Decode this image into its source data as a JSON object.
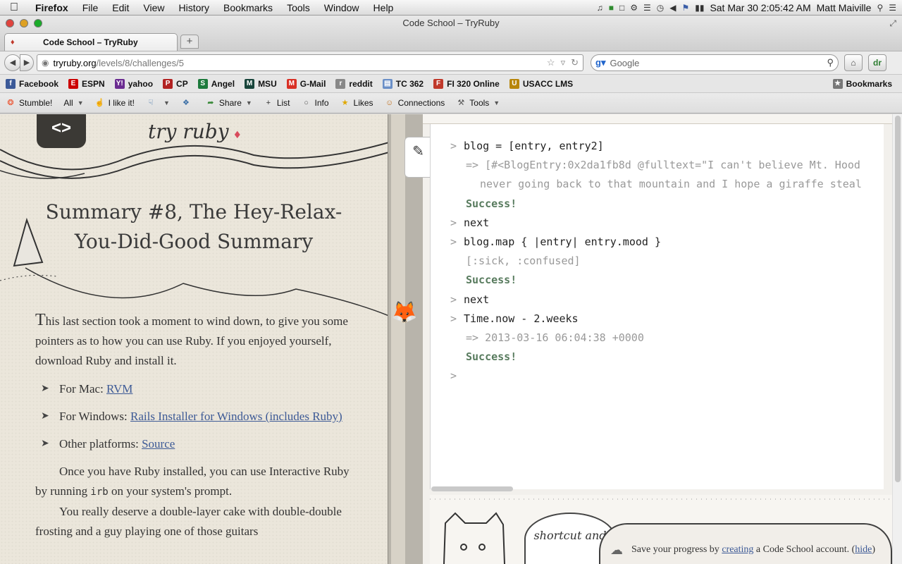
{
  "menubar": {
    "app_name": "Firefox",
    "items": [
      "File",
      "Edit",
      "View",
      "History",
      "Bookmarks",
      "Tools",
      "Window",
      "Help"
    ],
    "datetime": "Sat Mar 30  2:05:42 AM",
    "user": "Matt Maiville"
  },
  "window": {
    "title": "Code School – TryRuby",
    "tab_label": "Code School – TryRuby",
    "newtab_label": "+"
  },
  "navbar": {
    "url_host": "tryruby.org",
    "url_path": "/levels/8/challenges/5",
    "search_placeholder": "Google"
  },
  "bookmarks": {
    "items": [
      {
        "label": "Facebook",
        "icon": "facebook-icon",
        "color": "#3b5998",
        "glyph": "f"
      },
      {
        "label": "ESPN",
        "icon": "espn-icon",
        "color": "#cc0000",
        "glyph": "E"
      },
      {
        "label": "yahoo",
        "icon": "yahoo-icon",
        "color": "#6b2c91",
        "glyph": "Y!"
      },
      {
        "label": "CP",
        "icon": "cp-icon",
        "color": "#b22222",
        "glyph": "P"
      },
      {
        "label": "Angel",
        "icon": "angel-icon",
        "color": "#1d7a3c",
        "glyph": "S"
      },
      {
        "label": "MSU",
        "icon": "msu-icon",
        "color": "#18453b",
        "glyph": "M"
      },
      {
        "label": "G-Mail",
        "icon": "gmail-icon",
        "color": "#d93025",
        "glyph": "M"
      },
      {
        "label": "reddit",
        "icon": "reddit-icon",
        "color": "#888888",
        "glyph": "r"
      },
      {
        "label": "TC 362",
        "icon": "folder-icon",
        "color": "#6a8fc7",
        "glyph": "▤"
      },
      {
        "label": "FI 320 Online",
        "icon": "fi-icon",
        "color": "#c0392b",
        "glyph": "F"
      },
      {
        "label": "USACC LMS",
        "icon": "usacc-icon",
        "color": "#b8860b",
        "glyph": "U"
      }
    ],
    "right_label": "Bookmarks"
  },
  "stumblebar": {
    "items": [
      {
        "label": "Stumble!",
        "icon": "stumbleupon-icon",
        "glyph": "❂",
        "color": "#eb4924"
      },
      {
        "label": "All",
        "icon": "",
        "glyph": "",
        "color": "#333333"
      },
      {
        "label": "I like it!",
        "icon": "thumbs-up-icon",
        "glyph": "☝",
        "color": "#3a6ea5"
      },
      {
        "label": "",
        "icon": "thumbs-down-icon",
        "glyph": "☟",
        "color": "#3a6ea5"
      },
      {
        "label": "",
        "icon": "tag-icon",
        "glyph": "❖",
        "color": "#3a6ea5"
      },
      {
        "label": "Share",
        "icon": "share-icon",
        "glyph": "➦",
        "color": "#3a8a3a"
      },
      {
        "label": "List",
        "icon": "plus-icon",
        "glyph": "+",
        "color": "#333333"
      },
      {
        "label": "Info",
        "icon": "speech-bubble-icon",
        "glyph": "○",
        "color": "#555555"
      },
      {
        "label": "Likes",
        "icon": "star-icon",
        "glyph": "★",
        "color": "#e0a800"
      },
      {
        "label": "Connections",
        "icon": "people-icon",
        "glyph": "☺",
        "color": "#c07020"
      },
      {
        "label": "Tools",
        "icon": "tools-icon",
        "glyph": "⚒",
        "color": "#555555"
      }
    ]
  },
  "lesson": {
    "brand": "try ruby",
    "title": "Summary #8, The Hey-Relax-You-Did-Good Summary",
    "intro_cap": "T",
    "intro": "his last section took a moment to wind down, to give you some pointers as to how you can use Ruby. If you enjoyed yourself, download Ruby and install it.",
    "links": [
      {
        "label": "For Mac: ",
        "link": "RVM"
      },
      {
        "label": "For Windows: ",
        "link": "Rails Installer for Windows (includes Ruby)"
      },
      {
        "label": "Other platforms: ",
        "link": "Source"
      }
    ],
    "para2_before": "Once you have Ruby installed, you can use Interactive Ruby by running ",
    "para2_code": "irb",
    "para2_after": " on your system's prompt.",
    "para3": "You really deserve a double-layer cake with double-double frosting and a guy playing one of those guitars"
  },
  "console": {
    "lines": [
      {
        "kind": "cmd",
        "prompt": ">",
        "text": "blog = [entry, entry2]"
      },
      {
        "kind": "out",
        "prompt": "",
        "text": "=> [#<BlogEntry:0x2da1fb8d @fulltext=\"I can't believe Mt. Hood"
      },
      {
        "kind": "out",
        "prompt": "",
        "text": "  never going back to that mountain and I hope a giraffe steal"
      },
      {
        "kind": "ok",
        "prompt": "",
        "text": "Success!"
      },
      {
        "kind": "cmd",
        "prompt": ">",
        "text": "next"
      },
      {
        "kind": "cmd",
        "prompt": ">",
        "text": "blog.map { |entry| entry.mood }"
      },
      {
        "kind": "out",
        "prompt": "",
        "text": "[:sick, :confused]"
      },
      {
        "kind": "ok",
        "prompt": "",
        "text": "Success!"
      },
      {
        "kind": "cmd",
        "prompt": ">",
        "text": "next"
      },
      {
        "kind": "cmd",
        "prompt": ">",
        "text": "Time.now - 2.weeks"
      },
      {
        "kind": "out",
        "prompt": "",
        "text": "=> 2013-03-16 06:04:38 +0000"
      },
      {
        "kind": "ok",
        "prompt": "",
        "text": "Success!"
      },
      {
        "kind": "cmd",
        "prompt": ">",
        "text": ""
      }
    ]
  },
  "footer": {
    "cloud_note": "shortcut and",
    "save_before": "Save your progress by ",
    "save_link": "creating",
    "save_after": " a Code School account. (",
    "hide_link": "hide",
    "save_end": ")"
  }
}
